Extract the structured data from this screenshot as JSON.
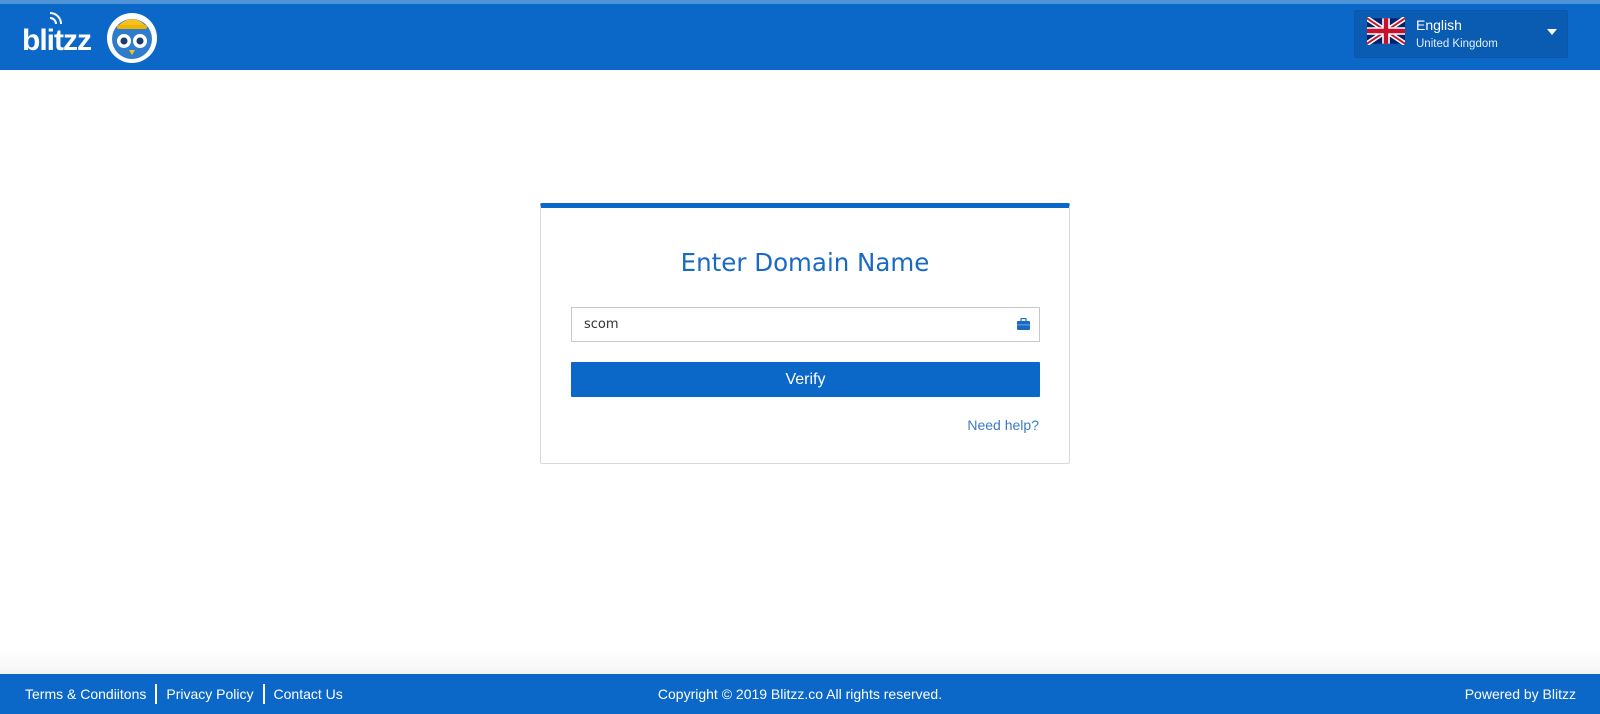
{
  "header": {
    "logo_text": "blitzz",
    "language": {
      "name": "English",
      "region": "United Kingdom",
      "flag_icon": "uk-flag-icon"
    }
  },
  "card": {
    "title": "Enter Domain Name",
    "domain_input": {
      "value": "scom",
      "icon": "briefcase-icon"
    },
    "verify_label": "Verify",
    "help_link": "Need help?"
  },
  "footer": {
    "links": [
      "Terms & Condiitons",
      "Privacy Policy",
      "Contact Us"
    ],
    "copyright": "Copyright © 2019 Blitzz.co All rights reserved.",
    "powered_by": "Powered by Blitzz"
  },
  "colors": {
    "brand_blue": "#0b68c8",
    "title_blue": "#1a6ac4",
    "link_blue": "#3a7bc6",
    "owl_yellow": "#f7c21e"
  }
}
